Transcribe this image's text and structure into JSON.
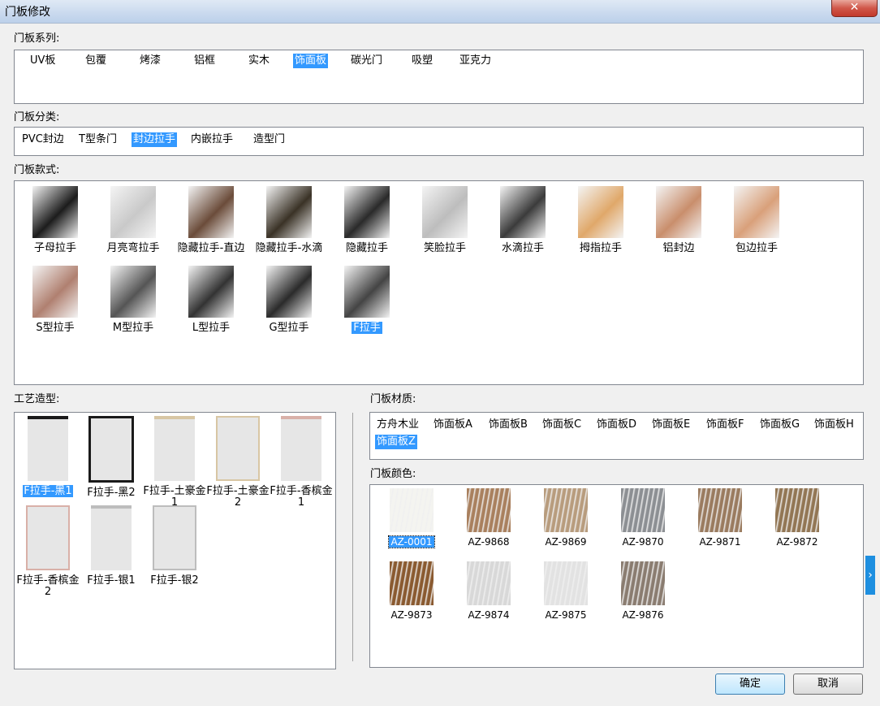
{
  "window": {
    "title": "门板修改",
    "close": "✕"
  },
  "series": {
    "label": "门板系列:",
    "items": [
      "UV板",
      "包覆",
      "烤漆",
      "铝框",
      "实木",
      "饰面板",
      "碳光门",
      "吸塑",
      "亚克力"
    ],
    "selected": 5
  },
  "category": {
    "label": "门板分类:",
    "items": [
      "PVC封边",
      "T型条门",
      "封边拉手",
      "内嵌拉手",
      "造型门"
    ],
    "selected": 2
  },
  "styles": {
    "label": "门板款式:",
    "items": [
      {
        "name": "子母拉手",
        "icon": "handle-black-profile-icon"
      },
      {
        "name": "月亮弯拉手",
        "icon": "handle-moon-curve-icon"
      },
      {
        "name": "隐藏拉手-直边",
        "icon": "handle-hidden-straight-icon"
      },
      {
        "name": "隐藏拉手-水滴",
        "icon": "handle-hidden-drop-icon"
      },
      {
        "name": "隐藏拉手",
        "icon": "handle-hidden-icon"
      },
      {
        "name": "笑脸拉手",
        "icon": "handle-smile-icon"
      },
      {
        "name": "水滴拉手",
        "icon": "handle-drop-icon"
      },
      {
        "name": "拇指拉手",
        "icon": "handle-thumb-icon"
      },
      {
        "name": "铝封边",
        "icon": "aluminum-edge-icon"
      },
      {
        "name": "包边拉手",
        "icon": "handle-wrap-edge-icon"
      },
      {
        "name": "S型拉手",
        "icon": "handle-s-icon"
      },
      {
        "name": "M型拉手",
        "icon": "handle-m-icon"
      },
      {
        "name": "L型拉手",
        "icon": "handle-l-icon"
      },
      {
        "name": "G型拉手",
        "icon": "handle-g-icon"
      },
      {
        "name": "F拉手",
        "icon": "handle-f-icon"
      }
    ],
    "selected": 14
  },
  "craft": {
    "label": "工艺造型:",
    "items": [
      {
        "name": "F拉手-黑1",
        "accent": "#1a1a1a"
      },
      {
        "name": "F拉手-黑2",
        "accent": "#1a1a1a"
      },
      {
        "name": "F拉手-土豪金1",
        "accent": "#d8c6a4"
      },
      {
        "name": "F拉手-土豪金2",
        "accent": "#d8c6a4"
      },
      {
        "name": "F拉手-香槟金1",
        "accent": "#d9b0a8"
      },
      {
        "name": "F拉手-香槟金2",
        "accent": "#d9b0a8"
      },
      {
        "name": "F拉手-银1",
        "accent": "#bdbdbd"
      },
      {
        "name": "F拉手-银2",
        "accent": "#bdbdbd"
      }
    ],
    "selected": 0
  },
  "material": {
    "label": "门板材质:",
    "items": [
      "方舟木业",
      "饰面板A",
      "饰面板B",
      "饰面板C",
      "饰面板D",
      "饰面板E",
      "饰面板F",
      "饰面板G",
      "饰面板H",
      "饰面板Z"
    ],
    "selected": 9
  },
  "colors": {
    "label": "门板颜色:",
    "items": [
      {
        "code": "AZ-0001",
        "color": "#f4f4f0"
      },
      {
        "code": "AZ-9868",
        "color": "#a9805e"
      },
      {
        "code": "AZ-9869",
        "color": "#b89c7d"
      },
      {
        "code": "AZ-9870",
        "color": "#8c8f93"
      },
      {
        "code": "AZ-9871",
        "color": "#9a7b5f"
      },
      {
        "code": "AZ-9872",
        "color": "#927654"
      },
      {
        "code": "AZ-9873",
        "color": "#8a5a30"
      },
      {
        "code": "AZ-9874",
        "color": "#d8d8d8"
      },
      {
        "code": "AZ-9875",
        "color": "#e2e2e2"
      },
      {
        "code": "AZ-9876",
        "color": "#8a7c70"
      }
    ],
    "selected": 0
  },
  "buttons": {
    "ok": "确定",
    "cancel": "取消"
  },
  "side_arrow": "›"
}
